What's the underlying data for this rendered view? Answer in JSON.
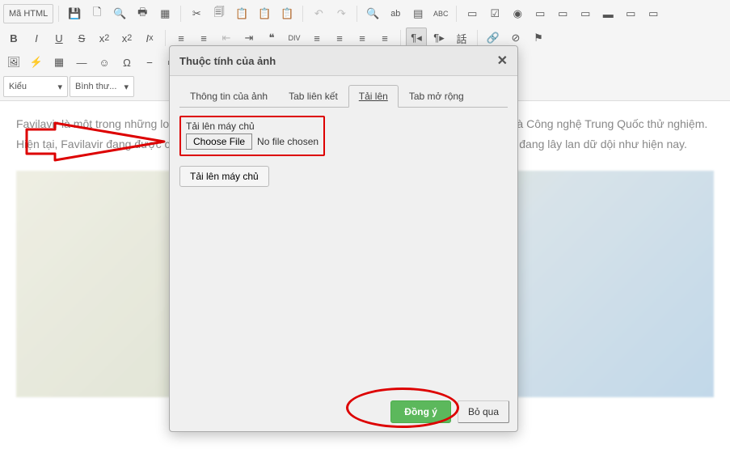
{
  "toolbar": {
    "source": "Mã HTML",
    "style_select": "Kiểu",
    "format_select": "Bình thư..."
  },
  "content": {
    "paragraph": "Favilavir là một trong những loại thuốc kháng virus dùng chữa virus Corona đã được Bộ Khoa học và Công nghệ Trung Quốc thử nghiệm. Hiện tại, Favilavir đang được coi là phương án khả thi nhằm cứu cánh cho người nhiễm corona vốn đang lây lan dữ dội như hiện nay."
  },
  "dialog": {
    "title": "Thuộc tính của ảnh",
    "tabs": {
      "info": "Thông tin của ảnh",
      "link": "Tab liên kết",
      "upload": "Tải lên",
      "advanced": "Tab mở rộng"
    },
    "upload": {
      "label": "Tải lên máy chủ",
      "choose_file": "Choose File",
      "no_file": "No file chosen",
      "server_btn": "Tải lên máy chủ"
    },
    "buttons": {
      "ok": "Đồng ý",
      "cancel": "Bỏ qua"
    }
  }
}
